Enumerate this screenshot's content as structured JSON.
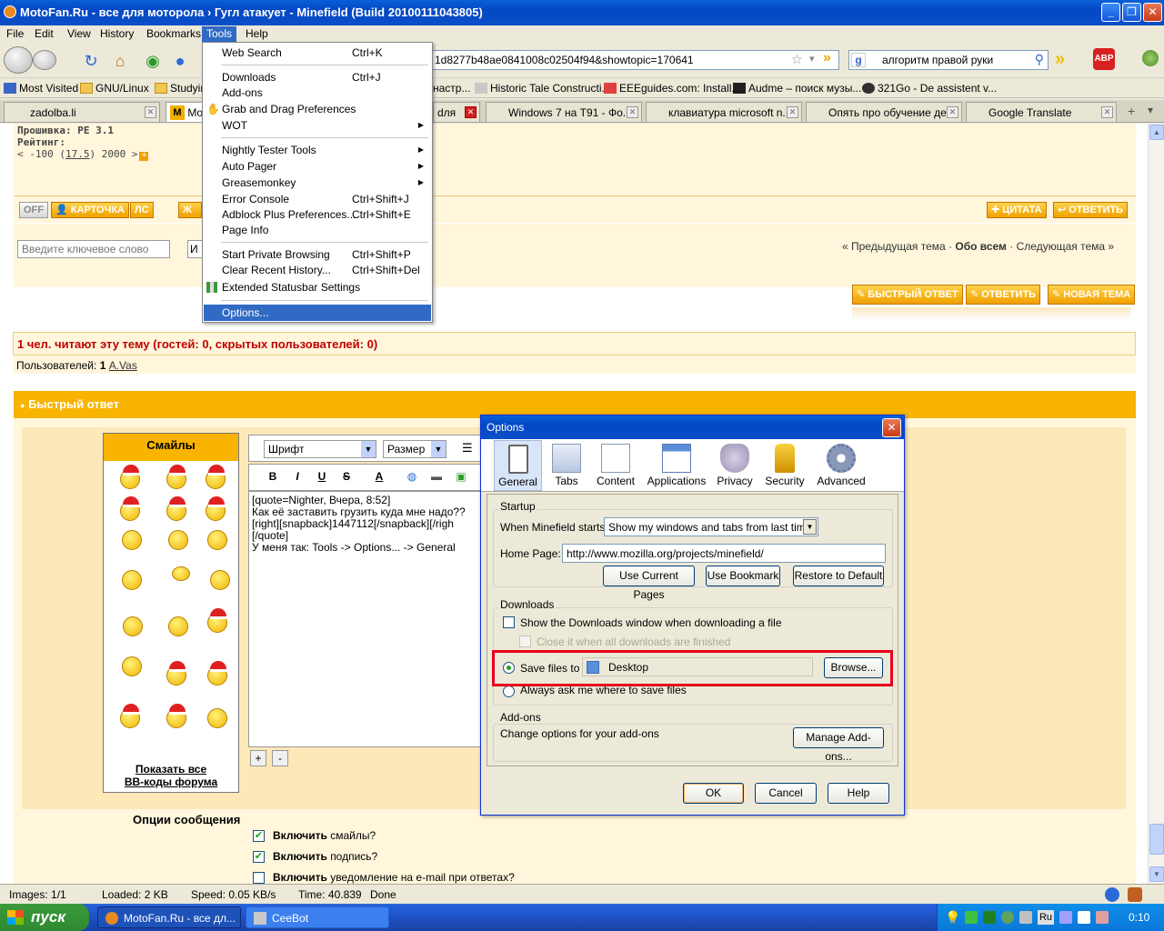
{
  "window": {
    "title": "MotoFan.Ru - все для моторола › Гугл атакует - Minefield (Build 20100111043805)",
    "min": "_",
    "max": "❐",
    "close": "✕"
  },
  "menubar": [
    "File",
    "Edit",
    "View",
    "History",
    "Bookmarks",
    "Tools",
    "Help"
  ],
  "navbar": {
    "url": "1d8277b48ae0841008c02504f94&showtopic=170641",
    "search_text": "алгоритм правой руки",
    "search_engine_letter": "g"
  },
  "bookmarks": [
    "Most Visited",
    "GNU/Linux",
    "Studyin",
    "настр...",
    "Historic Tale Constructi...",
    "EEEguides.com: Install...",
    "Audme – поиск музы...",
    "321Go - De assistent v..."
  ],
  "tabs": [
    "zadolba.li",
    "Mo",
    "dля",
    "Windows 7 на T91 - Фо...",
    "клавиатура microsoft n...",
    "Опять про обучение де...",
    "Google Translate"
  ],
  "tools_menu": {
    "items": [
      {
        "label": "Web Search",
        "shortcut": "Ctrl+K"
      },
      {
        "label": "Downloads",
        "shortcut": "Ctrl+J"
      },
      {
        "label": "Add-ons",
        "shortcut": ""
      },
      {
        "label": "Grab and Drag Preferences",
        "shortcut": ""
      },
      {
        "label": "WOT",
        "shortcut": ""
      },
      {
        "label": "Nightly Tester Tools",
        "shortcut": ""
      },
      {
        "label": "Auto Pager",
        "shortcut": ""
      },
      {
        "label": "Greasemonkey",
        "shortcut": ""
      },
      {
        "label": "Error Console",
        "shortcut": "Ctrl+Shift+J"
      },
      {
        "label": "Adblock Plus Preferences...",
        "shortcut": "Ctrl+Shift+E"
      },
      {
        "label": "Page Info",
        "shortcut": ""
      },
      {
        "label": "Start Private Browsing",
        "shortcut": "Ctrl+Shift+P"
      },
      {
        "label": "Clear Recent History...",
        "shortcut": "Ctrl+Shift+Del"
      },
      {
        "label": "Extended Statusbar Settings",
        "shortcut": ""
      },
      {
        "label": "Options...",
        "shortcut": ""
      }
    ]
  },
  "page": {
    "firmware": "Прошивка: PE 3.1",
    "rating_label": "Рейтинг:",
    "rating_line_pre": "< -100 (",
    "rating_value": "17.5",
    "rating_line_post": ") 2000 >",
    "off": "OFF",
    "card": "КАРТОЧКА",
    "ls": "ЛС",
    "zh": "Ж",
    "quote": "ЦИТАТА",
    "reply": "ОТВЕТИТЬ",
    "keyword_placeholder": "Введите ключевое слово",
    "search_btn": "И",
    "prev_topic": "« Предыдущая тема",
    "sep": "·",
    "current_topic": "Обо всем",
    "next_topic": "Следующая тема »",
    "fast_reply_btn": "БЫСТРЫЙ ОТВЕТ",
    "reply_btn": "ОТВЕТИТЬ",
    "new_topic_btn": "НОВАЯ ТЕМА",
    "readers": "1 чел. читают эту тему (гостей: 0, скрытых пользователей: 0)",
    "users_label": "Пользователей:",
    "users_count": "1",
    "user_name": "A.Vas",
    "quick_reply_title": "Быстрый ответ",
    "smileys_title": "Смайлы",
    "show_all": "Показать все",
    "bb_codes": "BB-коды форума",
    "font_select": "Шрифт",
    "size_select": "Размер",
    "editor_lines": [
      "[quote=Nighter, Вчера, 8:52]",
      "Как её заставить грузить куда мне надо??",
      "[right][snapback]1447112[/snapback][/righ",
      "[/quote]",
      "У меня так: Tools -> Options... -> General"
    ],
    "plus": "+",
    "minus": "-",
    "msg_options": "Опции сообщения",
    "opt1_bold": "Включить",
    "opt1_rest": "смайлы?",
    "opt2_bold": "Включить",
    "opt2_rest": "подпись?",
    "opt3_bold": "Включить",
    "opt3_rest": "уведомление на e-mail при ответах?",
    "check": "✔"
  },
  "dialog": {
    "title": "Options",
    "close": "✕",
    "panes": [
      "General",
      "Tabs",
      "Content",
      "Applications",
      "Privacy",
      "Security",
      "Advanced"
    ],
    "startup_group": "Startup",
    "when_starts_label": "When Minefield starts:",
    "when_starts_value": "Show my windows and tabs from last time",
    "home_page_label": "Home Page:",
    "home_page_value": "http://www.mozilla.org/projects/minefield/",
    "use_current": "Use Current Pages",
    "use_bookmark": "Use Bookmark",
    "restore_default": "Restore to Default",
    "downloads_group": "Downloads",
    "show_downloads": "Show the Downloads window when downloading a file",
    "close_when_done": "Close it when all downloads are finished",
    "save_files_to": "Save files to",
    "save_location": "Desktop",
    "browse": "Browse...",
    "always_ask": "Always ask me where to save files",
    "addons_group": "Add-ons",
    "addons_text": "Change options for your add-ons",
    "manage_addons": "Manage Add-ons...",
    "ok": "OK",
    "cancel": "Cancel",
    "help": "Help"
  },
  "status": {
    "images": "Images: 1/1",
    "loaded": "Loaded: 2 KB",
    "speed": "Speed: 0.05 KB/s",
    "time": "Time: 40.839",
    "done": "Done"
  },
  "taskbar": {
    "start": "пуск",
    "task1": "MotoFan.Ru - все дл...",
    "task2": "CeeBot",
    "lang": "Ru",
    "clock": "0:10"
  },
  "colors": {
    "accent": "#316ac5",
    "forum_orange": "#f8b400",
    "highlight_red": "#e8001c",
    "readers_red": "#c00000"
  }
}
